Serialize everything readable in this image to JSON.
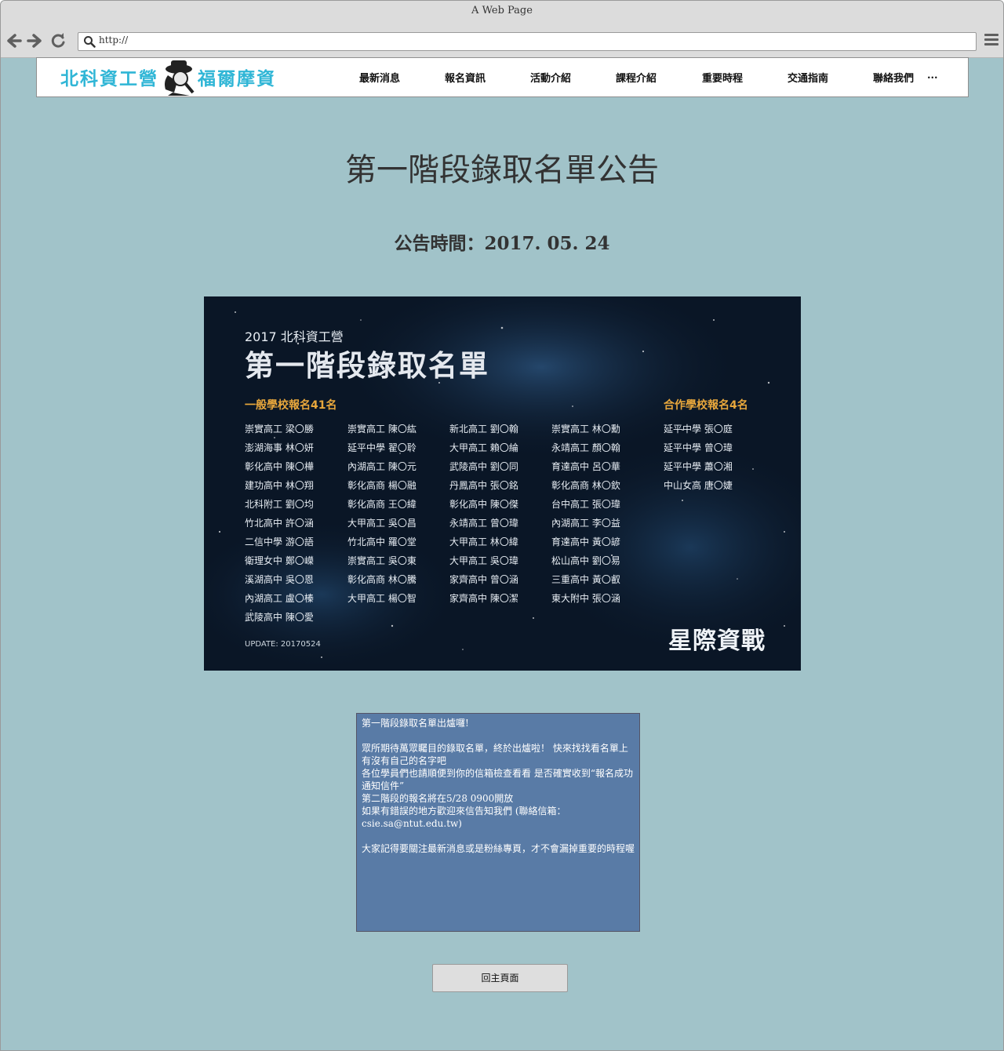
{
  "browser": {
    "title": "A Web Page",
    "url": "http://",
    "back_icon": "arrow-left-icon",
    "forward_icon": "arrow-right-icon",
    "reload_icon": "reload-icon",
    "search_icon": "search-icon",
    "menu_icon": "hamburger-menu-icon"
  },
  "header": {
    "logo_left": "北科資工營",
    "logo_right": "福爾摩資",
    "nav": [
      "最新消息",
      "報名資訊",
      "活動介紹",
      "課程介紹",
      "重要時程",
      "交通指南",
      "聯絡我們",
      "..."
    ]
  },
  "main": {
    "title": "第一階段錄取名單公告",
    "publish_time": "公告時間：2017. 05. 24"
  },
  "banner": {
    "subtitle": "2017 北科資工營",
    "title": "第一階段錄取名單",
    "general_heading": "一般學校報名41名",
    "partner_heading": "合作學校報名4名",
    "general_columns": [
      [
        "崇實高工 梁〇勝",
        "澎湖海事 林〇妍",
        "彰化高中 陳〇樺",
        "建功高中 林〇翔",
        "北科附工 劉〇均",
        "竹北高中 許〇涵",
        "二信中學 游〇語",
        "衛理女中 鄭〇嶸",
        "溪湖高中 吳〇恩",
        "內湖高工 盧〇榛",
        "武陵高中 陳〇愛"
      ],
      [
        "崇實高工 陳〇紘",
        "延平中學 翟〇聆",
        "內湖高工 陳〇元",
        "彰化高商 楊〇融",
        "彰化高商 王〇緯",
        "大甲高工 吳〇昌",
        "竹北高中 羅〇堂",
        "崇實高工 吳〇東",
        "彰化高商 林〇騰",
        "大甲高工 楊〇智"
      ],
      [
        "新北高工 劉〇翰",
        "大甲高工 賴〇綸",
        "武陵高中 劉〇同",
        "丹鳳高中 張〇銘",
        "彰化高中 陳〇傑",
        "永靖高工 曾〇瑋",
        "大甲高工 林〇緯",
        "大甲高工 吳〇瑋",
        "家齊高中 曾〇涵",
        "家齊高中 陳〇潔"
      ],
      [
        "崇實高工 林〇勳",
        "永靖高工 顏〇翰",
        "育達高中 呂〇華",
        "彰化高商 林〇欽",
        "台中高工 張〇瑋",
        "內湖高工 李〇益",
        "育達高中 黃〇諺",
        "松山高中 劉〇易",
        "三重高中 黃〇叡",
        "東大附中 張〇涵"
      ]
    ],
    "partner_list": [
      "延平中學 張〇庭",
      "延平中學 曾〇瑋",
      "延平中學 蕭〇湘",
      "中山女高 唐〇婕"
    ],
    "update": "UPDATE: 20170524",
    "brand": "星際資戰"
  },
  "notice": {
    "heading": "第一階段錄取名單出爐囉!",
    "para1": "眾所期待萬眾矚目的錄取名單，終於出爐啦！ 快來找找看名單上有沒有自己的名字吧",
    "para2": "各位學員們也請順便到你的信箱檢查看看 是否確實收到“報名成功通知信件”",
    "para3": "第二階段的報名將在5/28 0900開放",
    "para4": "如果有錯誤的地方歡迎來信告知我們 (聯絡信箱：csie.sa@ntut.edu.tw)",
    "para5": "大家記得要關注最新消息或是粉絲專頁，才不會漏掉重要的時程喔"
  },
  "back_button": "回主頁面"
}
